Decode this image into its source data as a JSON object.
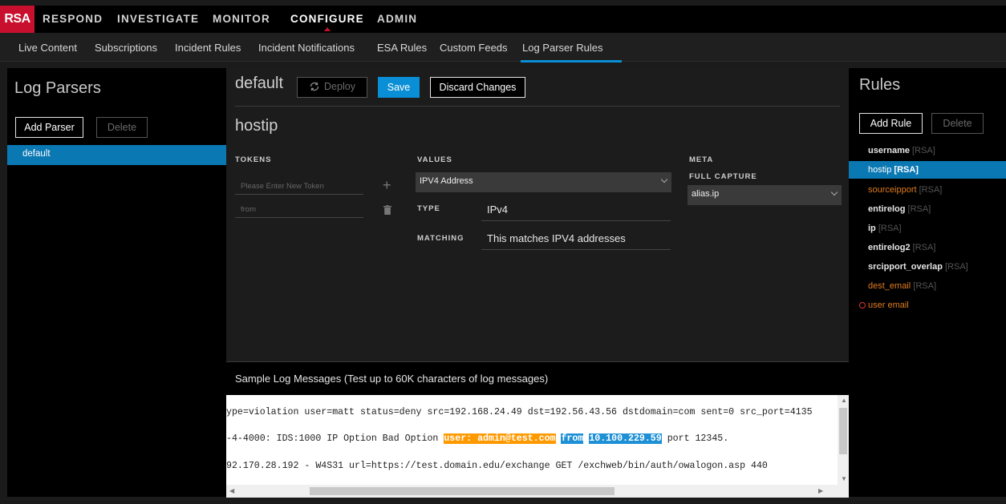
{
  "brand": {
    "logo": "RSA",
    "logo_color": "#c8102e"
  },
  "top_nav": [
    "RESPOND",
    "INVESTIGATE",
    "MONITOR",
    "CONFIGURE",
    "ADMIN"
  ],
  "top_nav_active": "CONFIGURE",
  "sub_nav": [
    "Live Content",
    "Subscriptions",
    "Incident Rules",
    "Incident Notifications",
    "ESA Rules",
    "Custom Feeds",
    "Log Parser Rules"
  ],
  "sub_nav_active": "Log Parser Rules",
  "left": {
    "title": "Log Parsers",
    "add_label": "Add Parser",
    "delete_label": "Delete",
    "parsers": [
      "default"
    ]
  },
  "center": {
    "parser_title": "default",
    "deploy_label": "Deploy",
    "save_label": "Save",
    "discard_label": "Discard Changes",
    "rule_name": "hostip",
    "tokens_head": "TOKENS",
    "values_head": "VALUES",
    "meta_head": "META",
    "token_placeholder": "Please Enter New Token",
    "token_existing": "from",
    "value_select": "IPV4 Address",
    "type_label": "TYPE",
    "type_value": "IPv4",
    "matching_label": "MATCHING",
    "matching_value": "This matches IPV4 addresses",
    "full_capture_label": "FULL CAPTURE",
    "meta_select": "alias.ip"
  },
  "sample": {
    "title": "Sample Log Messages (Test up to 60K characters of log messages)",
    "line1": "ype=violation user=matt status=deny src=192.168.24.49 dst=192.56.43.56 dstdomain=com sent=0 src_port=4135",
    "line2_a": "-4-4000: IDS:1000 IP Option Bad Option ",
    "line2_hl1": "user: admin@test.com",
    "line2_hl2": "from",
    "line2_hl3": "10.100.229.59",
    "line2_b": " port 12345.",
    "line3": "92.170.28.192 - W4S31 url=https://test.domain.edu/exchange GET /exchweb/bin/auth/owalogon.asp 440"
  },
  "right": {
    "title": "Rules",
    "add_label": "Add Rule",
    "delete_label": "Delete",
    "rules": [
      {
        "name": "username",
        "tag": "[RSA]"
      },
      {
        "name": "hostip",
        "tag": "[RSA]"
      },
      {
        "name": "sourceipport",
        "tag": "[RSA]"
      },
      {
        "name": "entirelog",
        "tag": "[RSA]"
      },
      {
        "name": "ip",
        "tag": "[RSA]"
      },
      {
        "name": "entirelog2",
        "tag": "[RSA]"
      },
      {
        "name": "srcipport_overlap",
        "tag": "[RSA]"
      },
      {
        "name": "dest_email",
        "tag": "[RSA]"
      },
      {
        "name": "user email",
        "tag": ""
      }
    ]
  },
  "colors": {
    "accent": "#0a8fd6",
    "selected_row": "#0a78b3",
    "warning": "#e07b1f",
    "error": "#e03131"
  }
}
